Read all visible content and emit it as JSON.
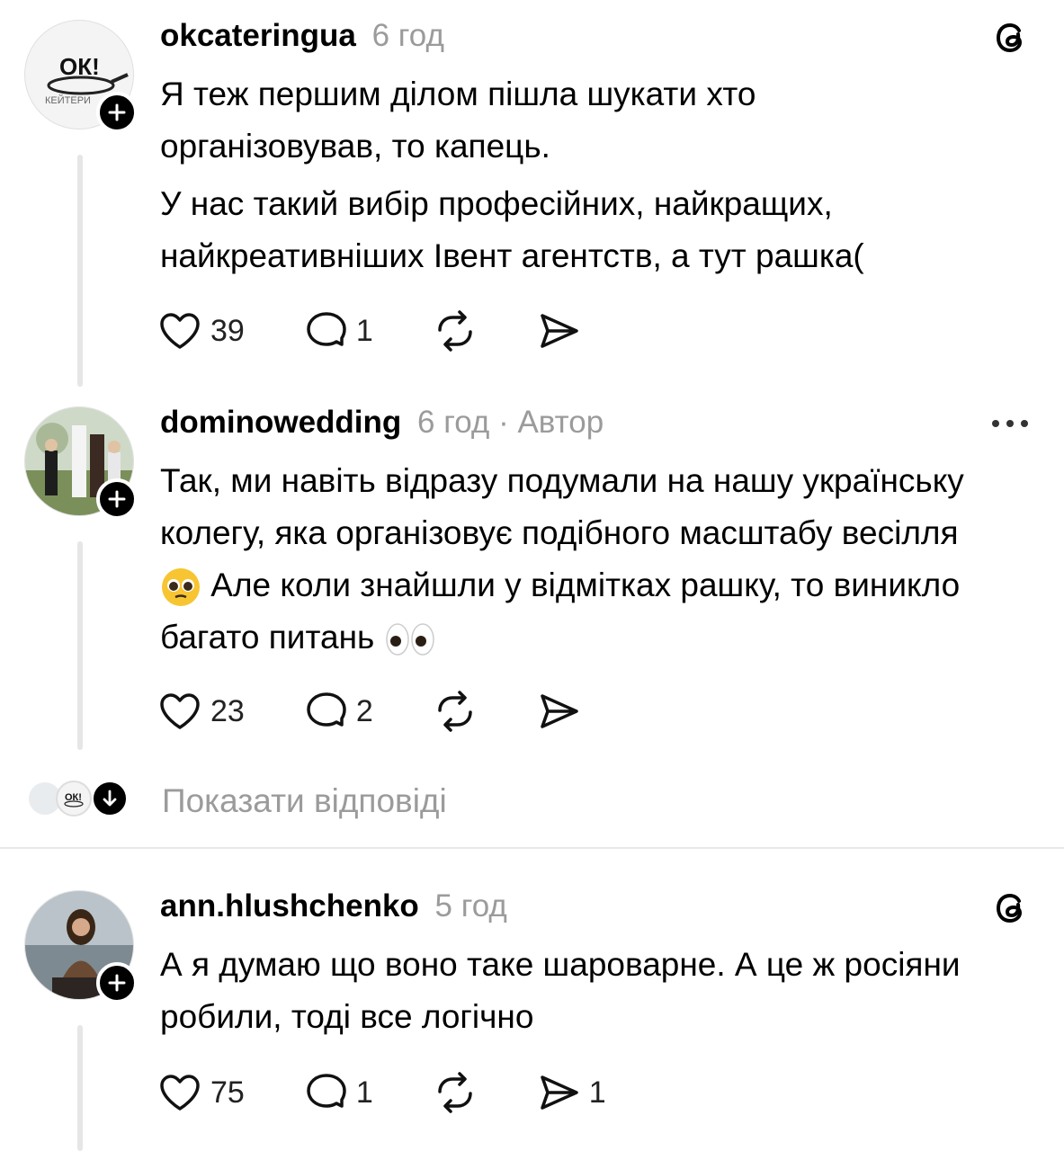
{
  "comments": [
    {
      "username": "okcateringua",
      "time": "6 год",
      "author_tag": "",
      "avatar_text_main": "ОК!",
      "avatar_text_sub": "КЕЙТЕРИ",
      "paragraphs": [
        "Я теж першим ділом пішла шукати хто організовував, то капець.",
        "У нас такий вибір професійних, найкращих, найкреативніших Івент агентств, а тут рашка("
      ],
      "likes": "39",
      "replies": "1",
      "shares": "",
      "top_icon": "threads-logo-icon"
    },
    {
      "username": "dominowedding",
      "time": "6 год",
      "author_tag": " · Автор",
      "paragraph_before_emoji": "Так, ми навіть відразу подумали на нашу українську колегу, яка організовує подібного масштабу весілля",
      "paragraph_after_emoji": "Але коли знайшли у відмітках рашку, то виникло багато питань",
      "likes": "23",
      "replies": "2",
      "shares": "",
      "top_icon": "more-options-icon"
    },
    {
      "username": "ann.hlushchenko",
      "time": "5 год",
      "author_tag": "",
      "paragraphs": [
        "А я думаю що воно таке шароварне. А це ж росіяни робили, тоді все логічно"
      ],
      "likes": "75",
      "replies": "1",
      "shares": "1",
      "top_icon": "threads-logo-icon"
    }
  ],
  "show_replies_label": "Показати відповіді",
  "colors": {
    "muted": "#9b9b9b",
    "line": "#e6e6e6",
    "badge": "#000000"
  }
}
